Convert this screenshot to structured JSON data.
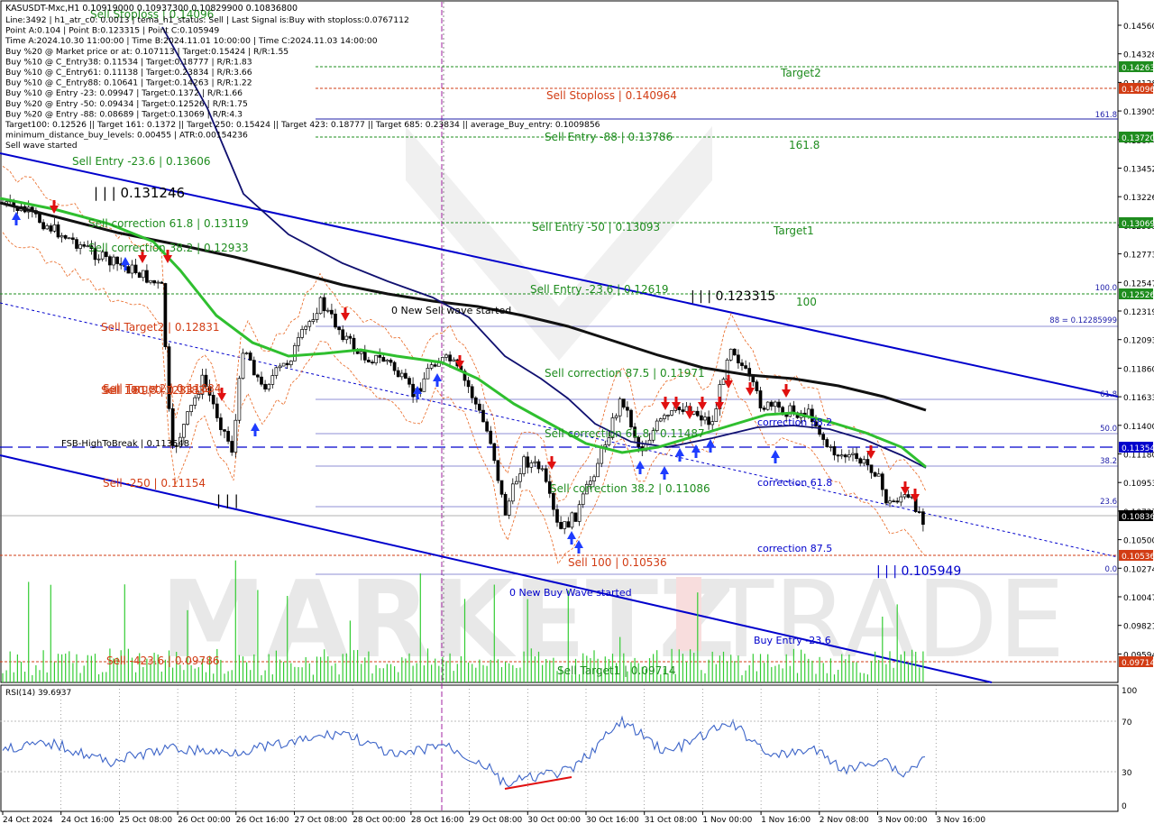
{
  "symbol_line": "KASUSDT-Mxc,H1  0.10919000 0.10937300 0.10829900 0.10836800",
  "info_lines": [
    "Line:3492 | h1_atr_c0: 0.0013 | tema_h1_status: Sell | Last Signal is:Buy with stoploss:0.0767112",
    "Point A:0.104 | Point B:0.123315 | Point C:0.105949",
    "Time A:2024.10.30 11:00:00 | Time B:2024.11.01 10:00:00 | Time C:2024.11.03 14:00:00",
    "Buy %20 @ Market price or at: 0.107113 | Target:0.15424 | R/R:1.55",
    "Buy %10 @ C_Entry38: 0.11534 | Target:0.18777 | R/R:1.83",
    "Buy %10 @ C_Entry61: 0.11138 | Target:0.23834 | R/R:3.66",
    "Buy %10 @ C_Entry88: 0.10641 | Target:0.14263 | R/R:1.22",
    "Buy %10 @ Entry -23: 0.09947 | Target:0.1372 | R/R:1.66",
    "Buy %20 @ Entry -50: 0.09434 | Target:0.12526 | R/R:1.75",
    "Buy %20 @ Entry -88: 0.08689 | Target:0.13069 | R/R:4.3",
    "Target100: 0.12526 || Target 161: 0.1372 || Target 250: 0.15424 || Target 423: 0.18777 || Target 685: 0.23834 || average_Buy_entry: 0.1009856",
    "minimum_distance_buy_levels: 0.00455 | ATR:0.00154236",
    "Sell wave started"
  ],
  "colors": {
    "green": "#1e8c1e",
    "red": "#d23c14",
    "blue": "#0000cc",
    "price_bg": "#000000",
    "resist_bg": "#d23c14",
    "support_bg": "#1e8c1e"
  },
  "price_axis": {
    "ticks": [
      "0.14560",
      "0.14328",
      "0.14128",
      "0.13905",
      "0.13674",
      "0.13452",
      "0.13226",
      "0.12999",
      "0.12773",
      "0.12547",
      "0.12319",
      "0.12093",
      "0.11860",
      "0.11633",
      "0.11400",
      "0.11180",
      "0.10953",
      "0.10727",
      "0.10500",
      "0.10274",
      "0.10047",
      "0.09821",
      "0.09594"
    ],
    "tags": [
      {
        "label": "0.14263",
        "kind": "green"
      },
      {
        "label": "0.14096",
        "kind": "red"
      },
      {
        "label": "0.13720",
        "kind": "green"
      },
      {
        "label": "0.13069",
        "kind": "green"
      },
      {
        "label": "0.12526",
        "kind": "green"
      },
      {
        "label": "0.11354",
        "kind": "blue"
      },
      {
        "label": "0.10836",
        "kind": "black"
      },
      {
        "label": "0.10536",
        "kind": "red"
      },
      {
        "label": "0.09714",
        "kind": "red"
      }
    ]
  },
  "time_axis": [
    "24 Oct 2024",
    "24 Oct 16:00",
    "25 Oct 08:00",
    "26 Oct 00:00",
    "26 Oct 16:00",
    "27 Oct 08:00",
    "28 Oct 00:00",
    "28 Oct 16:00",
    "29 Oct 08:00",
    "30 Oct 00:00",
    "30 Oct 16:00",
    "31 Oct 08:00",
    "1 Nov 00:00",
    "1 Nov 16:00",
    "2 Nov 08:00",
    "3 Nov 00:00",
    "3 Nov 16:00"
  ],
  "rsi": {
    "label": "RSI(14) 39.6937",
    "ticks": [
      "100",
      "70",
      "30",
      "0"
    ]
  },
  "watermark": {
    "left": "MARKETZ",
    "right": "TRADE"
  },
  "green_labels": [
    {
      "text": "Target2"
    },
    {
      "text": "Sell Entry -88 | 0.13786"
    },
    {
      "text": "161.8"
    },
    {
      "text": "Sell Entry -50 | 0.13093"
    },
    {
      "text": "Target1"
    },
    {
      "text": "Sell Entry -23.6 | 0.12619"
    },
    {
      "text": "100"
    },
    {
      "text": "Sell Target1 | 0.09714"
    },
    {
      "text": "Sell Entry -23.6 | 0.13606"
    },
    {
      "text": "Sell correction 61.8 | 0.13119"
    },
    {
      "text": "Sell correction 38.2 | 0.12933"
    },
    {
      "text": "Sell correction 87.5 | 0.11971"
    },
    {
      "text": "Sell correction 61.8 | 0.11487"
    },
    {
      "text": "Sell correction 38.2 | 0.11086"
    },
    {
      "text": "Sell Stoploss | 0.14096"
    }
  ],
  "red_labels": [
    {
      "text": "Sell Stoploss | 0.140964"
    },
    {
      "text": "Sell Target2 | 0.12831"
    },
    {
      "text": "Sell 100 | 0.12331"
    },
    {
      "text": "Sell Target2 | 0.11834"
    },
    {
      "text": "Sell 161.8 | 0.11834"
    },
    {
      "text": "Sell -250 | 0.11154"
    },
    {
      "text": "Sell -423.6 | 0.09786"
    }
  ],
  "blue_labels": [
    {
      "text": "correction 38.2"
    },
    {
      "text": "correction 61.8"
    },
    {
      "text": "correction 87.5"
    },
    {
      "text": "Buy Entry -23.6"
    },
    {
      "text": "0 New Buy Wave started"
    },
    {
      "text": "0 New Sell wave started"
    }
  ],
  "black_labels": [
    {
      "text": "| | | 0.131246"
    },
    {
      "text": "| | | 0.123315"
    },
    {
      "text": "| | | 0.105949"
    },
    {
      "text": "FSB-HighToBreak | 0.113548"
    },
    {
      "text": "Sell 100 | 0.10536"
    },
    {
      "text": "| | |"
    }
  ],
  "fib_labels": [
    {
      "text": "161.8"
    },
    {
      "text": "100.0"
    },
    {
      "text": "88 = 0.12285999"
    },
    {
      "text": "61.8"
    },
    {
      "text": "50.0"
    },
    {
      "text": "38.2"
    },
    {
      "text": "23.6"
    },
    {
      "text": "0.0"
    }
  ]
}
